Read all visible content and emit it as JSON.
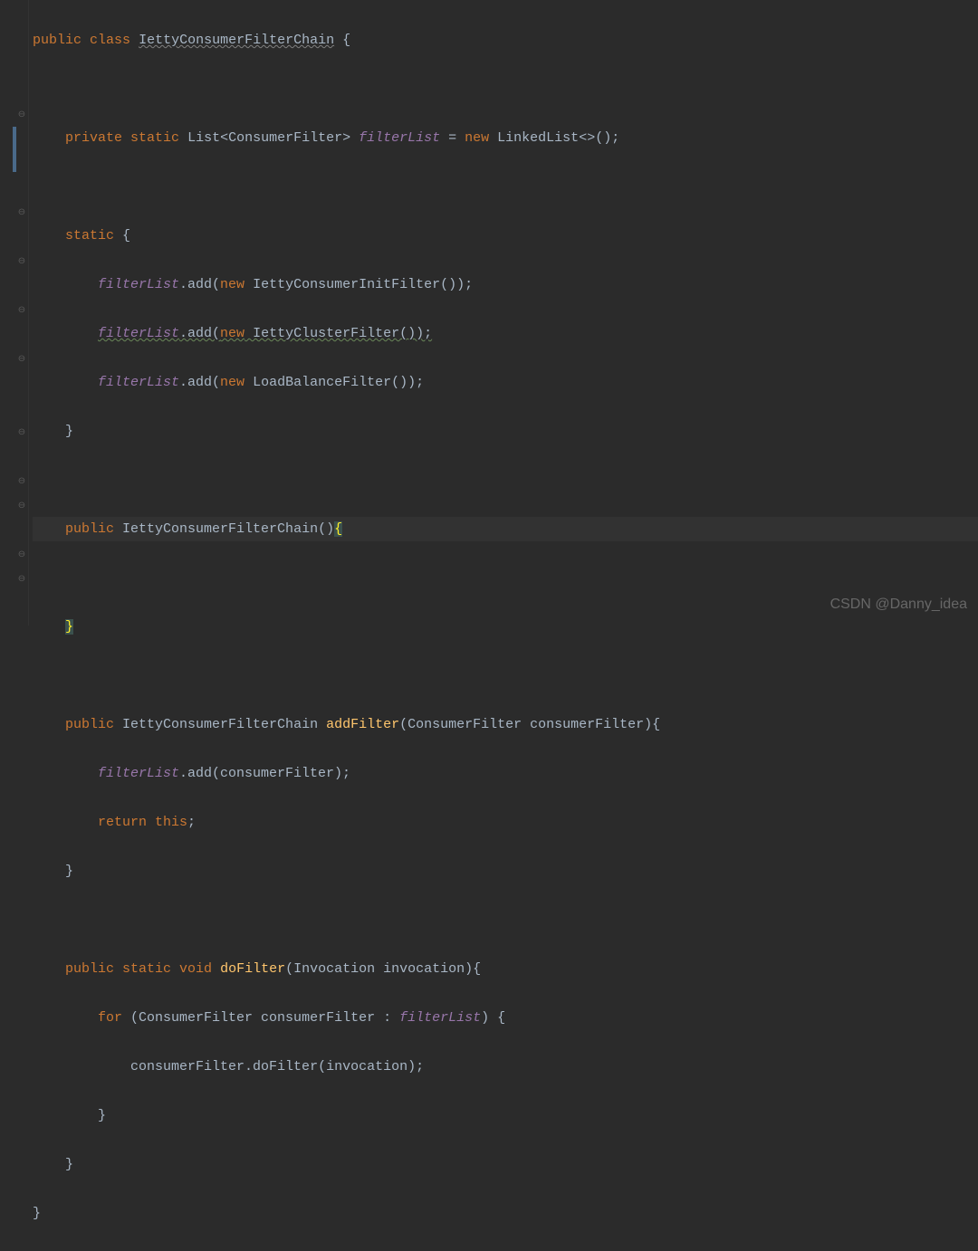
{
  "code": {
    "l1": {
      "kw1": "public",
      "kw2": "class",
      "cls": "IettyConsumerFilterChain",
      "brace": " {"
    },
    "l3": {
      "kw1": "private",
      "kw2": "static",
      "type": "List<ConsumerFilter>",
      "field": "filterList",
      "eq": " = ",
      "kw3": "new",
      "type2": " LinkedList<>();"
    },
    "l5": {
      "kw1": "static",
      "brace": " {"
    },
    "l6": {
      "field": "filterList",
      "method": ".add(",
      "kw": "new",
      "cls": " IettyConsumerInitFilter());"
    },
    "l7": {
      "field": "filterList",
      "method": ".add(",
      "kw": "new",
      "cls": " IettyClusterFilter());"
    },
    "l8": {
      "field": "filterList",
      "method": ".add(",
      "kw": "new",
      "cls": " LoadBalanceFilter());"
    },
    "l9": {
      "brace": "}"
    },
    "l11": {
      "kw1": "public",
      "cls": " IettyConsumerFilterChain()",
      "brace": "{"
    },
    "l13": {
      "brace": "}"
    },
    "l15": {
      "kw1": "public",
      "type": " IettyConsumerFilterChain ",
      "method": "addFilter",
      "params": "(ConsumerFilter consumerFilter){"
    },
    "l16": {
      "field": "filterList",
      "rest": ".add(consumerFilter);"
    },
    "l17": {
      "kw1": "return",
      "kw2": " this",
      "semi": ";"
    },
    "l18": {
      "brace": "}"
    },
    "l20": {
      "kw1": "public",
      "kw2": " static",
      "kw3": " void",
      "method": " doFilter",
      "params": "(Invocation invocation){"
    },
    "l21": {
      "kw1": "for",
      "rest1": " (ConsumerFilter consumerFilter : ",
      "field": "filterList",
      "rest2": ") {"
    },
    "l22": {
      "call": "consumerFilter.doFilter(invocation);"
    },
    "l23": {
      "brace": "}"
    },
    "l24": {
      "brace": "}"
    },
    "l25": {
      "brace": "}"
    }
  },
  "watermark": "CSDN @Danny_idea"
}
